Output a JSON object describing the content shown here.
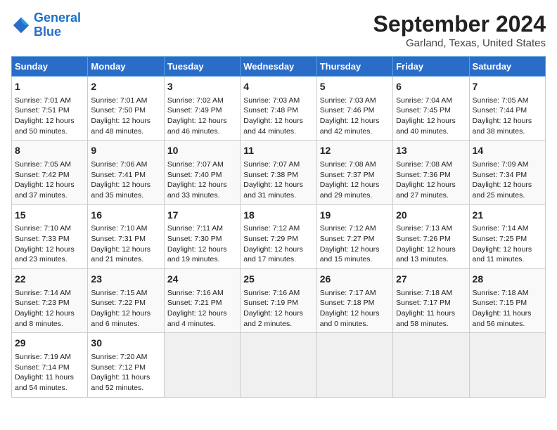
{
  "header": {
    "logo_line1": "General",
    "logo_line2": "Blue",
    "title": "September 2024",
    "subtitle": "Garland, Texas, United States"
  },
  "calendar": {
    "days_of_week": [
      "Sunday",
      "Monday",
      "Tuesday",
      "Wednesday",
      "Thursday",
      "Friday",
      "Saturday"
    ],
    "weeks": [
      [
        {
          "day": "1",
          "info": "Sunrise: 7:01 AM\nSunset: 7:51 PM\nDaylight: 12 hours\nand 50 minutes."
        },
        {
          "day": "2",
          "info": "Sunrise: 7:01 AM\nSunset: 7:50 PM\nDaylight: 12 hours\nand 48 minutes."
        },
        {
          "day": "3",
          "info": "Sunrise: 7:02 AM\nSunset: 7:49 PM\nDaylight: 12 hours\nand 46 minutes."
        },
        {
          "day": "4",
          "info": "Sunrise: 7:03 AM\nSunset: 7:48 PM\nDaylight: 12 hours\nand 44 minutes."
        },
        {
          "day": "5",
          "info": "Sunrise: 7:03 AM\nSunset: 7:46 PM\nDaylight: 12 hours\nand 42 minutes."
        },
        {
          "day": "6",
          "info": "Sunrise: 7:04 AM\nSunset: 7:45 PM\nDaylight: 12 hours\nand 40 minutes."
        },
        {
          "day": "7",
          "info": "Sunrise: 7:05 AM\nSunset: 7:44 PM\nDaylight: 12 hours\nand 38 minutes."
        }
      ],
      [
        {
          "day": "8",
          "info": "Sunrise: 7:05 AM\nSunset: 7:42 PM\nDaylight: 12 hours\nand 37 minutes."
        },
        {
          "day": "9",
          "info": "Sunrise: 7:06 AM\nSunset: 7:41 PM\nDaylight: 12 hours\nand 35 minutes."
        },
        {
          "day": "10",
          "info": "Sunrise: 7:07 AM\nSunset: 7:40 PM\nDaylight: 12 hours\nand 33 minutes."
        },
        {
          "day": "11",
          "info": "Sunrise: 7:07 AM\nSunset: 7:38 PM\nDaylight: 12 hours\nand 31 minutes."
        },
        {
          "day": "12",
          "info": "Sunrise: 7:08 AM\nSunset: 7:37 PM\nDaylight: 12 hours\nand 29 minutes."
        },
        {
          "day": "13",
          "info": "Sunrise: 7:08 AM\nSunset: 7:36 PM\nDaylight: 12 hours\nand 27 minutes."
        },
        {
          "day": "14",
          "info": "Sunrise: 7:09 AM\nSunset: 7:34 PM\nDaylight: 12 hours\nand 25 minutes."
        }
      ],
      [
        {
          "day": "15",
          "info": "Sunrise: 7:10 AM\nSunset: 7:33 PM\nDaylight: 12 hours\nand 23 minutes."
        },
        {
          "day": "16",
          "info": "Sunrise: 7:10 AM\nSunset: 7:31 PM\nDaylight: 12 hours\nand 21 minutes."
        },
        {
          "day": "17",
          "info": "Sunrise: 7:11 AM\nSunset: 7:30 PM\nDaylight: 12 hours\nand 19 minutes."
        },
        {
          "day": "18",
          "info": "Sunrise: 7:12 AM\nSunset: 7:29 PM\nDaylight: 12 hours\nand 17 minutes."
        },
        {
          "day": "19",
          "info": "Sunrise: 7:12 AM\nSunset: 7:27 PM\nDaylight: 12 hours\nand 15 minutes."
        },
        {
          "day": "20",
          "info": "Sunrise: 7:13 AM\nSunset: 7:26 PM\nDaylight: 12 hours\nand 13 minutes."
        },
        {
          "day": "21",
          "info": "Sunrise: 7:14 AM\nSunset: 7:25 PM\nDaylight: 12 hours\nand 11 minutes."
        }
      ],
      [
        {
          "day": "22",
          "info": "Sunrise: 7:14 AM\nSunset: 7:23 PM\nDaylight: 12 hours\nand 8 minutes."
        },
        {
          "day": "23",
          "info": "Sunrise: 7:15 AM\nSunset: 7:22 PM\nDaylight: 12 hours\nand 6 minutes."
        },
        {
          "day": "24",
          "info": "Sunrise: 7:16 AM\nSunset: 7:21 PM\nDaylight: 12 hours\nand 4 minutes."
        },
        {
          "day": "25",
          "info": "Sunrise: 7:16 AM\nSunset: 7:19 PM\nDaylight: 12 hours\nand 2 minutes."
        },
        {
          "day": "26",
          "info": "Sunrise: 7:17 AM\nSunset: 7:18 PM\nDaylight: 12 hours\nand 0 minutes."
        },
        {
          "day": "27",
          "info": "Sunrise: 7:18 AM\nSunset: 7:17 PM\nDaylight: 11 hours\nand 58 minutes."
        },
        {
          "day": "28",
          "info": "Sunrise: 7:18 AM\nSunset: 7:15 PM\nDaylight: 11 hours\nand 56 minutes."
        }
      ],
      [
        {
          "day": "29",
          "info": "Sunrise: 7:19 AM\nSunset: 7:14 PM\nDaylight: 11 hours\nand 54 minutes."
        },
        {
          "day": "30",
          "info": "Sunrise: 7:20 AM\nSunset: 7:12 PM\nDaylight: 11 hours\nand 52 minutes."
        },
        {
          "day": "",
          "info": ""
        },
        {
          "day": "",
          "info": ""
        },
        {
          "day": "",
          "info": ""
        },
        {
          "day": "",
          "info": ""
        },
        {
          "day": "",
          "info": ""
        }
      ]
    ]
  }
}
